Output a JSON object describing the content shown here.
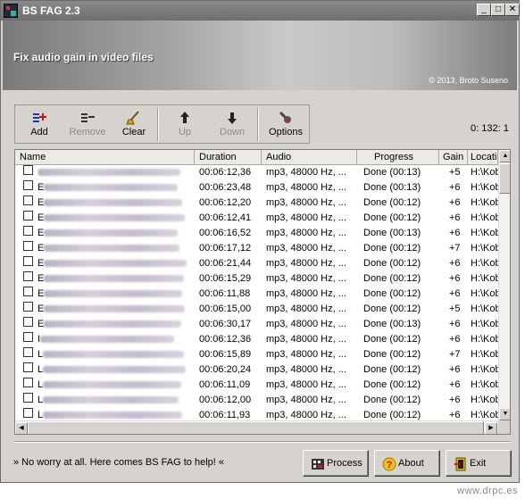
{
  "window": {
    "title": "BS FAG 2.3",
    "subtitle": "Fix audio gain in video files",
    "copyright": "© 2013, Broto Suseno"
  },
  "toolbar": {
    "add": {
      "label": "Add",
      "icon": "add-icon"
    },
    "remove": {
      "label": "Remove",
      "icon": "remove-icon"
    },
    "clear": {
      "label": "Clear",
      "icon": "clear-icon"
    },
    "up": {
      "label": "Up",
      "icon": "arrow-up-icon"
    },
    "down": {
      "label": "Down",
      "icon": "arrow-down-icon"
    },
    "options": {
      "label": "Options",
      "icon": "options-icon"
    }
  },
  "counter": "0:  132:  1",
  "table": {
    "columns": [
      "Name",
      "Duration",
      "Audio",
      "Progress",
      "Gain",
      "Location"
    ],
    "rows": [
      {
        "name_visible": "",
        "duration": "00:06:12,36",
        "audio": "mp3, 48000 Hz, ...",
        "progress": "Done (00:13)",
        "gain": "+5",
        "location": "H:\\Kob"
      },
      {
        "name_visible": "E",
        "duration": "00:06:23,48",
        "audio": "mp3, 48000 Hz, ...",
        "progress": "Done (00:13)",
        "gain": "+6",
        "location": "H:\\Kob"
      },
      {
        "name_visible": "E",
        "duration": "00:06:12,20",
        "audio": "mp3, 48000 Hz, ...",
        "progress": "Done (00:12)",
        "gain": "+6",
        "location": "H:\\Kob"
      },
      {
        "name_visible": "E",
        "duration": "00:06:12,41",
        "audio": "mp3, 48000 Hz, ...",
        "progress": "Done (00:12)",
        "gain": "+6",
        "location": "H:\\Kob"
      },
      {
        "name_visible": "E",
        "duration": "00:06:16,52",
        "audio": "mp3, 48000 Hz, ...",
        "progress": "Done (00:13)",
        "gain": "+6",
        "location": "H:\\Kob"
      },
      {
        "name_visible": "E",
        "duration": "00:06:17,12",
        "audio": "mp3, 48000 Hz, ...",
        "progress": "Done (00:12)",
        "gain": "+7",
        "location": "H:\\Kob"
      },
      {
        "name_visible": "E",
        "duration": "00:06:21,44",
        "audio": "mp3, 48000 Hz, ...",
        "progress": "Done (00:12)",
        "gain": "+6",
        "location": "H:\\Kob"
      },
      {
        "name_visible": "E",
        "duration": "00:06:15,29",
        "audio": "mp3, 48000 Hz, ...",
        "progress": "Done (00:12)",
        "gain": "+6",
        "location": "H:\\Kob"
      },
      {
        "name_visible": "E",
        "duration": "00:06:11,88",
        "audio": "mp3, 48000 Hz, ...",
        "progress": "Done (00:12)",
        "gain": "+6",
        "location": "H:\\Kob"
      },
      {
        "name_visible": "E",
        "duration": "00:06:15,00",
        "audio": "mp3, 48000 Hz, ...",
        "progress": "Done (00:12)",
        "gain": "+5",
        "location": "H:\\Kob"
      },
      {
        "name_visible": "E",
        "duration": "00:06:30,17",
        "audio": "mp3, 48000 Hz, ...",
        "progress": "Done (00:13)",
        "gain": "+6",
        "location": "H:\\Kob"
      },
      {
        "name_visible": "I",
        "duration": "00:06:12,36",
        "audio": "mp3, 48000 Hz, ...",
        "progress": "Done (00:12)",
        "gain": "+6",
        "location": "H:\\Kob"
      },
      {
        "name_visible": "L",
        "duration": "00:06:15,89",
        "audio": "mp3, 48000 Hz, ...",
        "progress": "Done (00:12)",
        "gain": "+7",
        "location": "H:\\Kob"
      },
      {
        "name_visible": "L",
        "duration": "00:06:20,24",
        "audio": "mp3, 48000 Hz, ...",
        "progress": "Done (00:12)",
        "gain": "+6",
        "location": "H:\\Kob"
      },
      {
        "name_visible": "L",
        "duration": "00:06:11,09",
        "audio": "mp3, 48000 Hz, ...",
        "progress": "Done (00:12)",
        "gain": "+6",
        "location": "H:\\Kob"
      },
      {
        "name_visible": "L",
        "duration": "00:06:12,00",
        "audio": "mp3, 48000 Hz, ...",
        "progress": "Done (00:12)",
        "gain": "+6",
        "location": "H:\\Kob"
      },
      {
        "name_visible": "L",
        "duration": "00:06:11,93",
        "audio": "mp3, 48000 Hz, ...",
        "progress": "Done (00:12)",
        "gain": "+6",
        "location": "H:\\Kob"
      }
    ]
  },
  "status_text": "» No worry at all. Here comes BS FAG to help! «",
  "buttons": {
    "process": {
      "label": "Process",
      "icon": "process-icon"
    },
    "about": {
      "label": "About",
      "icon": "question-icon"
    },
    "exit": {
      "label": "Exit",
      "icon": "exit-icon"
    }
  },
  "watermark": "www.drpc.es",
  "colors": {
    "title_bar": "#7a7a7a",
    "window_face": "#d6d3ce",
    "disabled_text": "#8a8a8a"
  }
}
